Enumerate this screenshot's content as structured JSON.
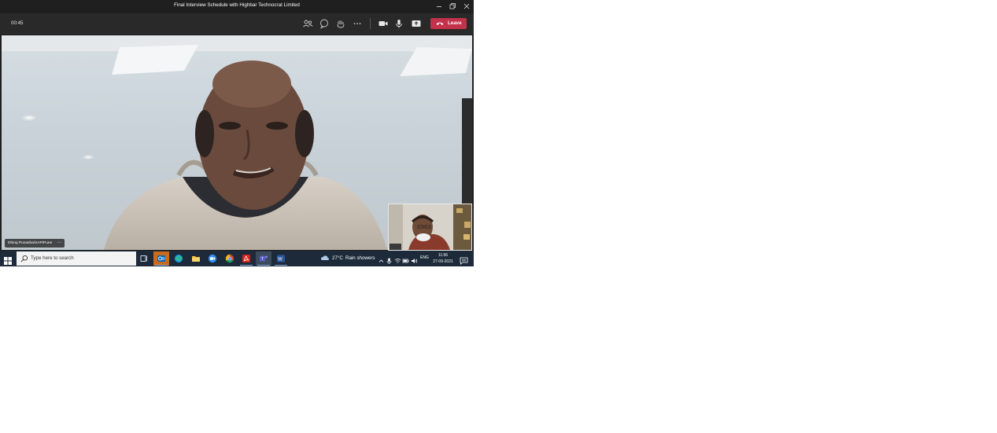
{
  "window": {
    "title": "Final Interview Schedule with Highbar Technocrat Limited",
    "controls": [
      "minimize-icon",
      "restore-icon",
      "close-icon"
    ]
  },
  "toolbar": {
    "timer": "00:45",
    "icons": [
      "participants-icon",
      "chat-icon",
      "raise-hand-icon",
      "more-icon",
      "camera-icon",
      "microphone-icon",
      "share-screen-icon"
    ],
    "leave_label": "Leave",
    "leave_color": "#c4314b"
  },
  "video": {
    "participant_name": "Dhiraj Punasha/SAP/Pune",
    "more": "···"
  },
  "taskbar": {
    "search_placeholder": "Type here to search",
    "apps": [
      "task-view-icon",
      "outlook-icon",
      "edge-icon",
      "file-explorer-icon",
      "zoom-icon",
      "chrome-icon",
      "acrobat-icon",
      "teams-icon",
      "word-icon"
    ],
    "weather_temp": "27°C",
    "weather_desc": "Rain showers",
    "language": "ENG",
    "time": "11:56",
    "date": "27-09-2021"
  }
}
